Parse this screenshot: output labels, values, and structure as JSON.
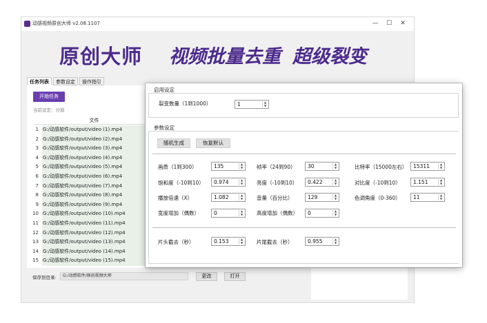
{
  "window": {
    "title": "动感视频原创大师 v2.08.1107",
    "controls": {
      "minimize": "—",
      "maximize": "☐",
      "close": "✕"
    }
  },
  "banner": {
    "main": "原创大师",
    "sub1": "视频批量去重",
    "sub2": "超级裂变"
  },
  "tabs": [
    {
      "label": "任务列表",
      "active": true
    },
    {
      "label": "参数设定",
      "active": false
    },
    {
      "label": "操作指引",
      "active": false
    }
  ],
  "task_panel": {
    "start_button": "开始任务",
    "current_setting": "当前设定：分割",
    "file_column_header": "文件",
    "files": [
      {
        "num": "1",
        "path": "G:/动感软件/output/video (1).mp4"
      },
      {
        "num": "2",
        "path": "G:/动感软件/output/video (2).mp4"
      },
      {
        "num": "3",
        "path": "G:/动感软件/output/video (3).mp4"
      },
      {
        "num": "4",
        "path": "G:/动感软件/output/video (4).mp4"
      },
      {
        "num": "5",
        "path": "G:/动感软件/output/video (5).mp4"
      },
      {
        "num": "6",
        "path": "G:/动感软件/output/video (6).mp4"
      },
      {
        "num": "7",
        "path": "G:/动感软件/output/video (7).mp4"
      },
      {
        "num": "8",
        "path": "G:/动感软件/output/video (8).mp4"
      },
      {
        "num": "9",
        "path": "G:/动感软件/output/video (9).mp4"
      },
      {
        "num": "10",
        "path": "G:/动感软件/output/video (10).mp4"
      },
      {
        "num": "11",
        "path": "G:/动感软件/output/video (11).mp4"
      },
      {
        "num": "12",
        "path": "G:/动感软件/output/video (12).mp4"
      },
      {
        "num": "13",
        "path": "G:/动感软件/output/video (13).mp4"
      },
      {
        "num": "14",
        "path": "G:/动感软件/output/video (14).mp4"
      },
      {
        "num": "15",
        "path": "G:/动感软件/output/video (15).mp4"
      }
    ]
  },
  "save": {
    "label": "保存到目录:",
    "path": "G:/动感软件/原创视频大师",
    "change_button": "更改",
    "open_button": "打开"
  },
  "dialog": {
    "enable_section": {
      "title": "启用设定",
      "split_count_label": "裂变数量（1到1000）",
      "split_count_value": "1"
    },
    "params_section": {
      "title": "参数设定",
      "random_button": "随机生成",
      "reset_button": "恢复默认",
      "fields": {
        "quality_label": "画质（1到300）",
        "quality_value": "135",
        "fps_label": "帧率（24到90）",
        "fps_value": "30",
        "bitrate_label": "比特率（15000左右）",
        "bitrate_value": "15311",
        "saturation_label": "饱和度（-10到10）",
        "saturation_value": "0.974",
        "brightness_label": "亮度（-10到10）",
        "brightness_value": "0.422",
        "contrast_label": "对比度（-10到10）",
        "contrast_value": "1.151",
        "speed_label": "播放倍速（X）",
        "speed_value": "1.082",
        "volume_label": "音量（百分比）",
        "volume_value": "129",
        "hue_label": "色调角度（0-360）",
        "hue_value": "11",
        "width_add_label": "宽度增加（偶数）",
        "width_add_value": "0",
        "height_add_label": "高度增加（偶数）",
        "height_add_value": "0",
        "head_cut_label": "片头截去（秒）",
        "head_cut_value": "0.153",
        "tail_cut_label": "片尾截去（秒）",
        "tail_cut_value": "0.955"
      }
    }
  }
}
